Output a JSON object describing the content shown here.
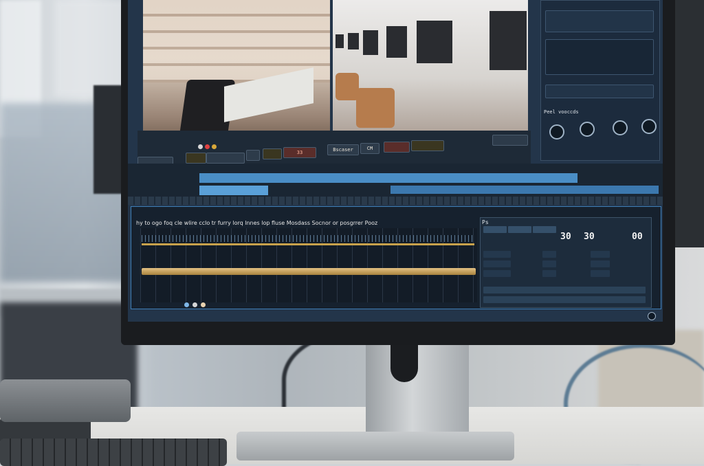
{
  "scene": "photo-of-monitor-running-video-editor",
  "toolbar_top": {
    "buttons": [
      "33",
      "Bscaser",
      "CM"
    ]
  },
  "waveform": {
    "title": "hy to ogo foq cle wlire cclo tr furry lorq lnnes lop fluse Mosdass Socnor or posgrrer Pooz"
  },
  "data_panel": {
    "header": "Ps",
    "values": [
      "30",
      "30",
      "00"
    ]
  },
  "right_panel": {
    "section_label": "Peel vooccds"
  },
  "colors": {
    "screen_bg": "#23354a",
    "timeline_blue": "#4a8ec6",
    "waveform_gold": "#c9a24b",
    "accent_border": "#3f7fb8"
  }
}
